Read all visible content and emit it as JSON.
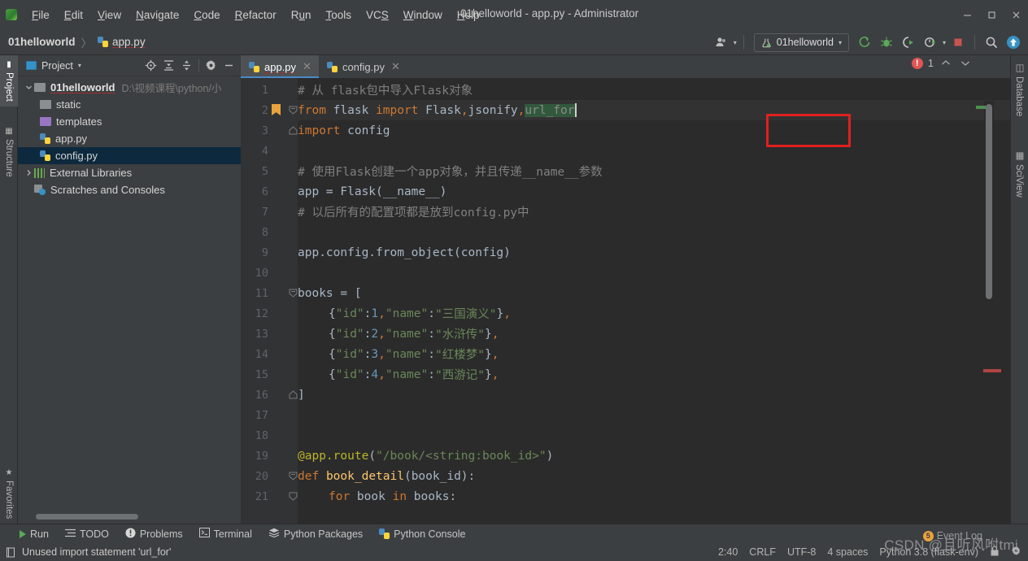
{
  "window": {
    "title": "01helloworld - app.py - Administrator",
    "minimize": "–",
    "maximize": "❐",
    "close": "✕"
  },
  "menu": [
    {
      "label": "File"
    },
    {
      "label": "Edit"
    },
    {
      "label": "View"
    },
    {
      "label": "Navigate"
    },
    {
      "label": "Code"
    },
    {
      "label": "Refactor"
    },
    {
      "label": "Run"
    },
    {
      "label": "Tools"
    },
    {
      "label": "VCS"
    },
    {
      "label": "Window"
    },
    {
      "label": "Help"
    }
  ],
  "breadcrumb": {
    "project": "01helloworld",
    "separator": "〉",
    "file": "app.py"
  },
  "toolbar": {
    "run_config": "01helloworld",
    "caret": "▾",
    "icons": [
      "user-icon",
      "run-icon",
      "debug-icon",
      "coverage-icon",
      "profile-icon",
      "stop-icon",
      "search-icon",
      "update-icon"
    ]
  },
  "left_strip": [
    {
      "label": "Project",
      "active": true
    },
    {
      "label": "Structure",
      "active": false
    },
    {
      "label": "Favorites",
      "active": false
    }
  ],
  "right_strip": [
    {
      "label": "Database"
    },
    {
      "label": "SciView"
    }
  ],
  "project_panel": {
    "title": "Project",
    "title_caret": "▾",
    "tools": [
      "locate-icon",
      "expand-all-icon",
      "collapse-all-icon",
      "settings-gear-icon",
      "hide-icon"
    ],
    "tree": [
      {
        "label": "01helloworld",
        "path": "D:\\视频课程\\python/小",
        "kind": "root",
        "expanded": true,
        "depth": 0,
        "selected": false
      },
      {
        "label": "static",
        "kind": "folder",
        "depth": 1,
        "selected": false
      },
      {
        "label": "templates",
        "kind": "folder-purple",
        "depth": 1,
        "selected": false
      },
      {
        "label": "app.py",
        "kind": "python",
        "depth": 1,
        "selected": false
      },
      {
        "label": "config.py",
        "kind": "python",
        "depth": 1,
        "selected": true
      },
      {
        "label": "External Libraries",
        "kind": "libs",
        "expanded": false,
        "depth": 0,
        "selected": false
      },
      {
        "label": "Scratches and Consoles",
        "kind": "scratch",
        "depth": 0,
        "selected": false
      }
    ]
  },
  "editor": {
    "tabs": [
      {
        "label": "app.py",
        "active": true,
        "close": "✕"
      },
      {
        "label": "config.py",
        "active": false,
        "close": "✕"
      }
    ],
    "inspection": {
      "error_count": "1",
      "up": "⌃",
      "down": "⌄"
    },
    "cursor_line_index": 1,
    "lines": [
      {
        "num": "1",
        "bookmark": false,
        "fold": "",
        "indent": 0,
        "tokens": [
          {
            "t": "# 从 flask包中导入Flask对象",
            "c": "cmt"
          }
        ]
      },
      {
        "num": "2",
        "bookmark": true,
        "fold": "down",
        "indent": 0,
        "tokens": [
          {
            "t": "from",
            "c": "kw"
          },
          {
            "t": " flask ",
            "c": "txt"
          },
          {
            "t": "import",
            "c": "kw"
          },
          {
            "t": " Flask",
            "c": "txt"
          },
          {
            "t": ",",
            "c": "punct"
          },
          {
            "t": "jsonify",
            "c": "txt"
          },
          {
            "t": ",",
            "c": "punct"
          },
          {
            "t": "url_for",
            "c": "sel-green"
          }
        ]
      },
      {
        "num": "3",
        "bookmark": false,
        "fold": "up",
        "indent": 0,
        "tokens": [
          {
            "t": "import",
            "c": "kw"
          },
          {
            "t": " config",
            "c": "txt"
          }
        ]
      },
      {
        "num": "4",
        "bookmark": false,
        "fold": "",
        "indent": 0,
        "tokens": []
      },
      {
        "num": "5",
        "bookmark": false,
        "fold": "",
        "indent": 0,
        "tokens": [
          {
            "t": "# 使用Flask创建一个app对象，并且传递__name__参数",
            "c": "cmt"
          }
        ]
      },
      {
        "num": "6",
        "bookmark": false,
        "fold": "",
        "indent": 0,
        "tokens": [
          {
            "t": "app = Flask(__name__)",
            "c": "txt"
          }
        ]
      },
      {
        "num": "7",
        "bookmark": false,
        "fold": "",
        "indent": 0,
        "tokens": [
          {
            "t": "# 以后所有的配置项都是放到config.py中",
            "c": "cmt"
          }
        ]
      },
      {
        "num": "8",
        "bookmark": false,
        "fold": "",
        "indent": 0,
        "tokens": []
      },
      {
        "num": "9",
        "bookmark": false,
        "fold": "",
        "indent": 0,
        "tokens": [
          {
            "t": "app.config.from_object(config)",
            "c": "txt"
          }
        ]
      },
      {
        "num": "10",
        "bookmark": false,
        "fold": "",
        "indent": 0,
        "tokens": []
      },
      {
        "num": "11",
        "bookmark": false,
        "fold": "down",
        "indent": 0,
        "tokens": [
          {
            "t": "books = [",
            "c": "txt"
          }
        ]
      },
      {
        "num": "12",
        "bookmark": false,
        "fold": "",
        "indent": 1,
        "tokens": [
          {
            "t": "{",
            "c": "txt"
          },
          {
            "t": "\"id\"",
            "c": "str"
          },
          {
            "t": ":",
            "c": "txt"
          },
          {
            "t": "1",
            "c": "num"
          },
          {
            "t": ",",
            "c": "punct"
          },
          {
            "t": "\"name\"",
            "c": "str"
          },
          {
            "t": ":",
            "c": "txt"
          },
          {
            "t": "\"三国演义\"",
            "c": "str"
          },
          {
            "t": "}",
            "c": "txt"
          },
          {
            "t": ",",
            "c": "punct"
          }
        ]
      },
      {
        "num": "13",
        "bookmark": false,
        "fold": "",
        "indent": 1,
        "tokens": [
          {
            "t": "{",
            "c": "txt"
          },
          {
            "t": "\"id\"",
            "c": "str"
          },
          {
            "t": ":",
            "c": "txt"
          },
          {
            "t": "2",
            "c": "num"
          },
          {
            "t": ",",
            "c": "punct"
          },
          {
            "t": "\"name\"",
            "c": "str"
          },
          {
            "t": ":",
            "c": "txt"
          },
          {
            "t": "\"水浒传\"",
            "c": "str"
          },
          {
            "t": "}",
            "c": "txt"
          },
          {
            "t": ",",
            "c": "punct"
          }
        ]
      },
      {
        "num": "14",
        "bookmark": false,
        "fold": "",
        "indent": 1,
        "tokens": [
          {
            "t": "{",
            "c": "txt"
          },
          {
            "t": "\"id\"",
            "c": "str"
          },
          {
            "t": ":",
            "c": "txt"
          },
          {
            "t": "3",
            "c": "num"
          },
          {
            "t": ",",
            "c": "punct"
          },
          {
            "t": "\"name\"",
            "c": "str"
          },
          {
            "t": ":",
            "c": "txt"
          },
          {
            "t": "\"红楼梦\"",
            "c": "str"
          },
          {
            "t": "}",
            "c": "txt"
          },
          {
            "t": ",",
            "c": "punct"
          }
        ]
      },
      {
        "num": "15",
        "bookmark": false,
        "fold": "",
        "indent": 1,
        "tokens": [
          {
            "t": "{",
            "c": "txt"
          },
          {
            "t": "\"id\"",
            "c": "str"
          },
          {
            "t": ":",
            "c": "txt"
          },
          {
            "t": "4",
            "c": "num"
          },
          {
            "t": ",",
            "c": "punct"
          },
          {
            "t": "\"name\"",
            "c": "str"
          },
          {
            "t": ":",
            "c": "txt"
          },
          {
            "t": "\"西游记\"",
            "c": "str"
          },
          {
            "t": "}",
            "c": "txt"
          },
          {
            "t": ",",
            "c": "punct"
          }
        ]
      },
      {
        "num": "16",
        "bookmark": false,
        "fold": "up",
        "indent": 0,
        "tokens": [
          {
            "t": "]",
            "c": "txt"
          }
        ]
      },
      {
        "num": "17",
        "bookmark": false,
        "fold": "",
        "indent": 0,
        "tokens": []
      },
      {
        "num": "18",
        "bookmark": false,
        "fold": "",
        "indent": 0,
        "tokens": []
      },
      {
        "num": "19",
        "bookmark": false,
        "fold": "",
        "indent": 0,
        "tokens": [
          {
            "t": "@app.route",
            "c": "dec"
          },
          {
            "t": "(",
            "c": "txt"
          },
          {
            "t": "\"/book/<string:book_id>\"",
            "c": "str"
          },
          {
            "t": ")",
            "c": "txt"
          }
        ]
      },
      {
        "num": "20",
        "bookmark": false,
        "fold": "down",
        "indent": 0,
        "tokens": [
          {
            "t": "def",
            "c": "kw"
          },
          {
            "t": " ",
            "c": "txt"
          },
          {
            "t": "book_detail",
            "c": "fn"
          },
          {
            "t": "(book_id):",
            "c": "txt"
          }
        ]
      },
      {
        "num": "21",
        "bookmark": false,
        "fold": "down2",
        "indent": 1,
        "tokens": [
          {
            "t": "for",
            "c": "kw"
          },
          {
            "t": " book ",
            "c": "txt"
          },
          {
            "t": "in",
            "c": "kw"
          },
          {
            "t": " books:",
            "c": "txt"
          }
        ]
      }
    ]
  },
  "bottom_tools": [
    {
      "label": "Run",
      "icon": "run-triangle-icon"
    },
    {
      "label": "TODO",
      "icon": "todo-list-icon"
    },
    {
      "label": "Problems",
      "icon": "problems-icon"
    },
    {
      "label": "Terminal",
      "icon": "terminal-icon"
    },
    {
      "label": "Python Packages",
      "icon": "packages-icon"
    },
    {
      "label": "Python Console",
      "icon": "console-icon"
    }
  ],
  "statusbar": {
    "message": "Unused import statement 'url_for'",
    "position": "2:40",
    "line_separator": "CRLF",
    "encoding": "UTF-8",
    "indent": "4 spaces",
    "interpreter": "Python 3.8 (flask-env)",
    "event_log": "Event Log",
    "event_count": "5"
  },
  "watermark": "CSDN @且听风咐tmj"
}
